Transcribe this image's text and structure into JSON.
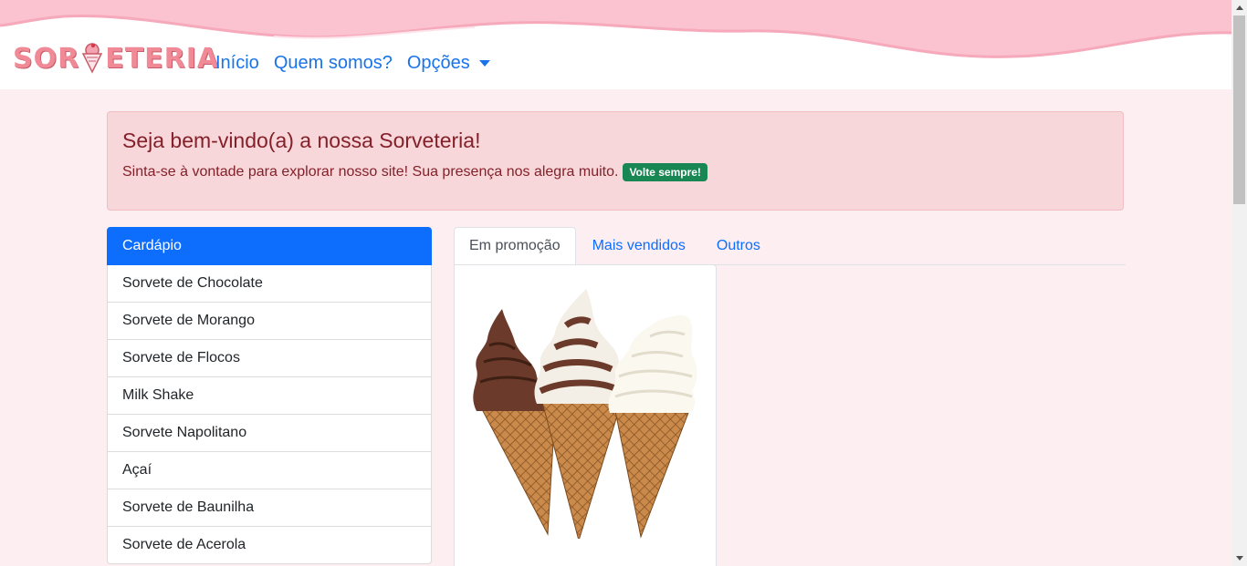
{
  "header": {
    "logo_text_left": "SOR",
    "logo_text_right": "ETERIA",
    "nav": [
      {
        "label": "Início"
      },
      {
        "label": "Quem somos?"
      },
      {
        "label": "Opções"
      }
    ]
  },
  "alert": {
    "title": "Seja bem-vindo(a) a nossa Sorveteria!",
    "message": "Sinta-se à vontade para explorar nosso site! Sua presença nos alegra muito.",
    "badge": "Volte sempre!"
  },
  "menu": {
    "header": "Cardápio",
    "items": [
      "Sorvete de Chocolate",
      "Sorvete de Morango",
      "Sorvete de Flocos",
      "Milk Shake",
      "Sorvete Napolitano",
      "Açaí",
      "Sorvete de Baunilha",
      "Sorvete de Acerola"
    ]
  },
  "tabs": [
    {
      "label": "Em promoção",
      "active": true
    },
    {
      "label": "Mais vendidos"
    },
    {
      "label": "Outros"
    }
  ],
  "colors": {
    "header_wave": "#fbc2cf",
    "page_bg": "#fdeef2",
    "nav_link": "#1a73e8",
    "alert_bg": "#f8d7da",
    "alert_text": "#842029",
    "badge_bg": "#198754",
    "active_item": "#0d6efd"
  }
}
